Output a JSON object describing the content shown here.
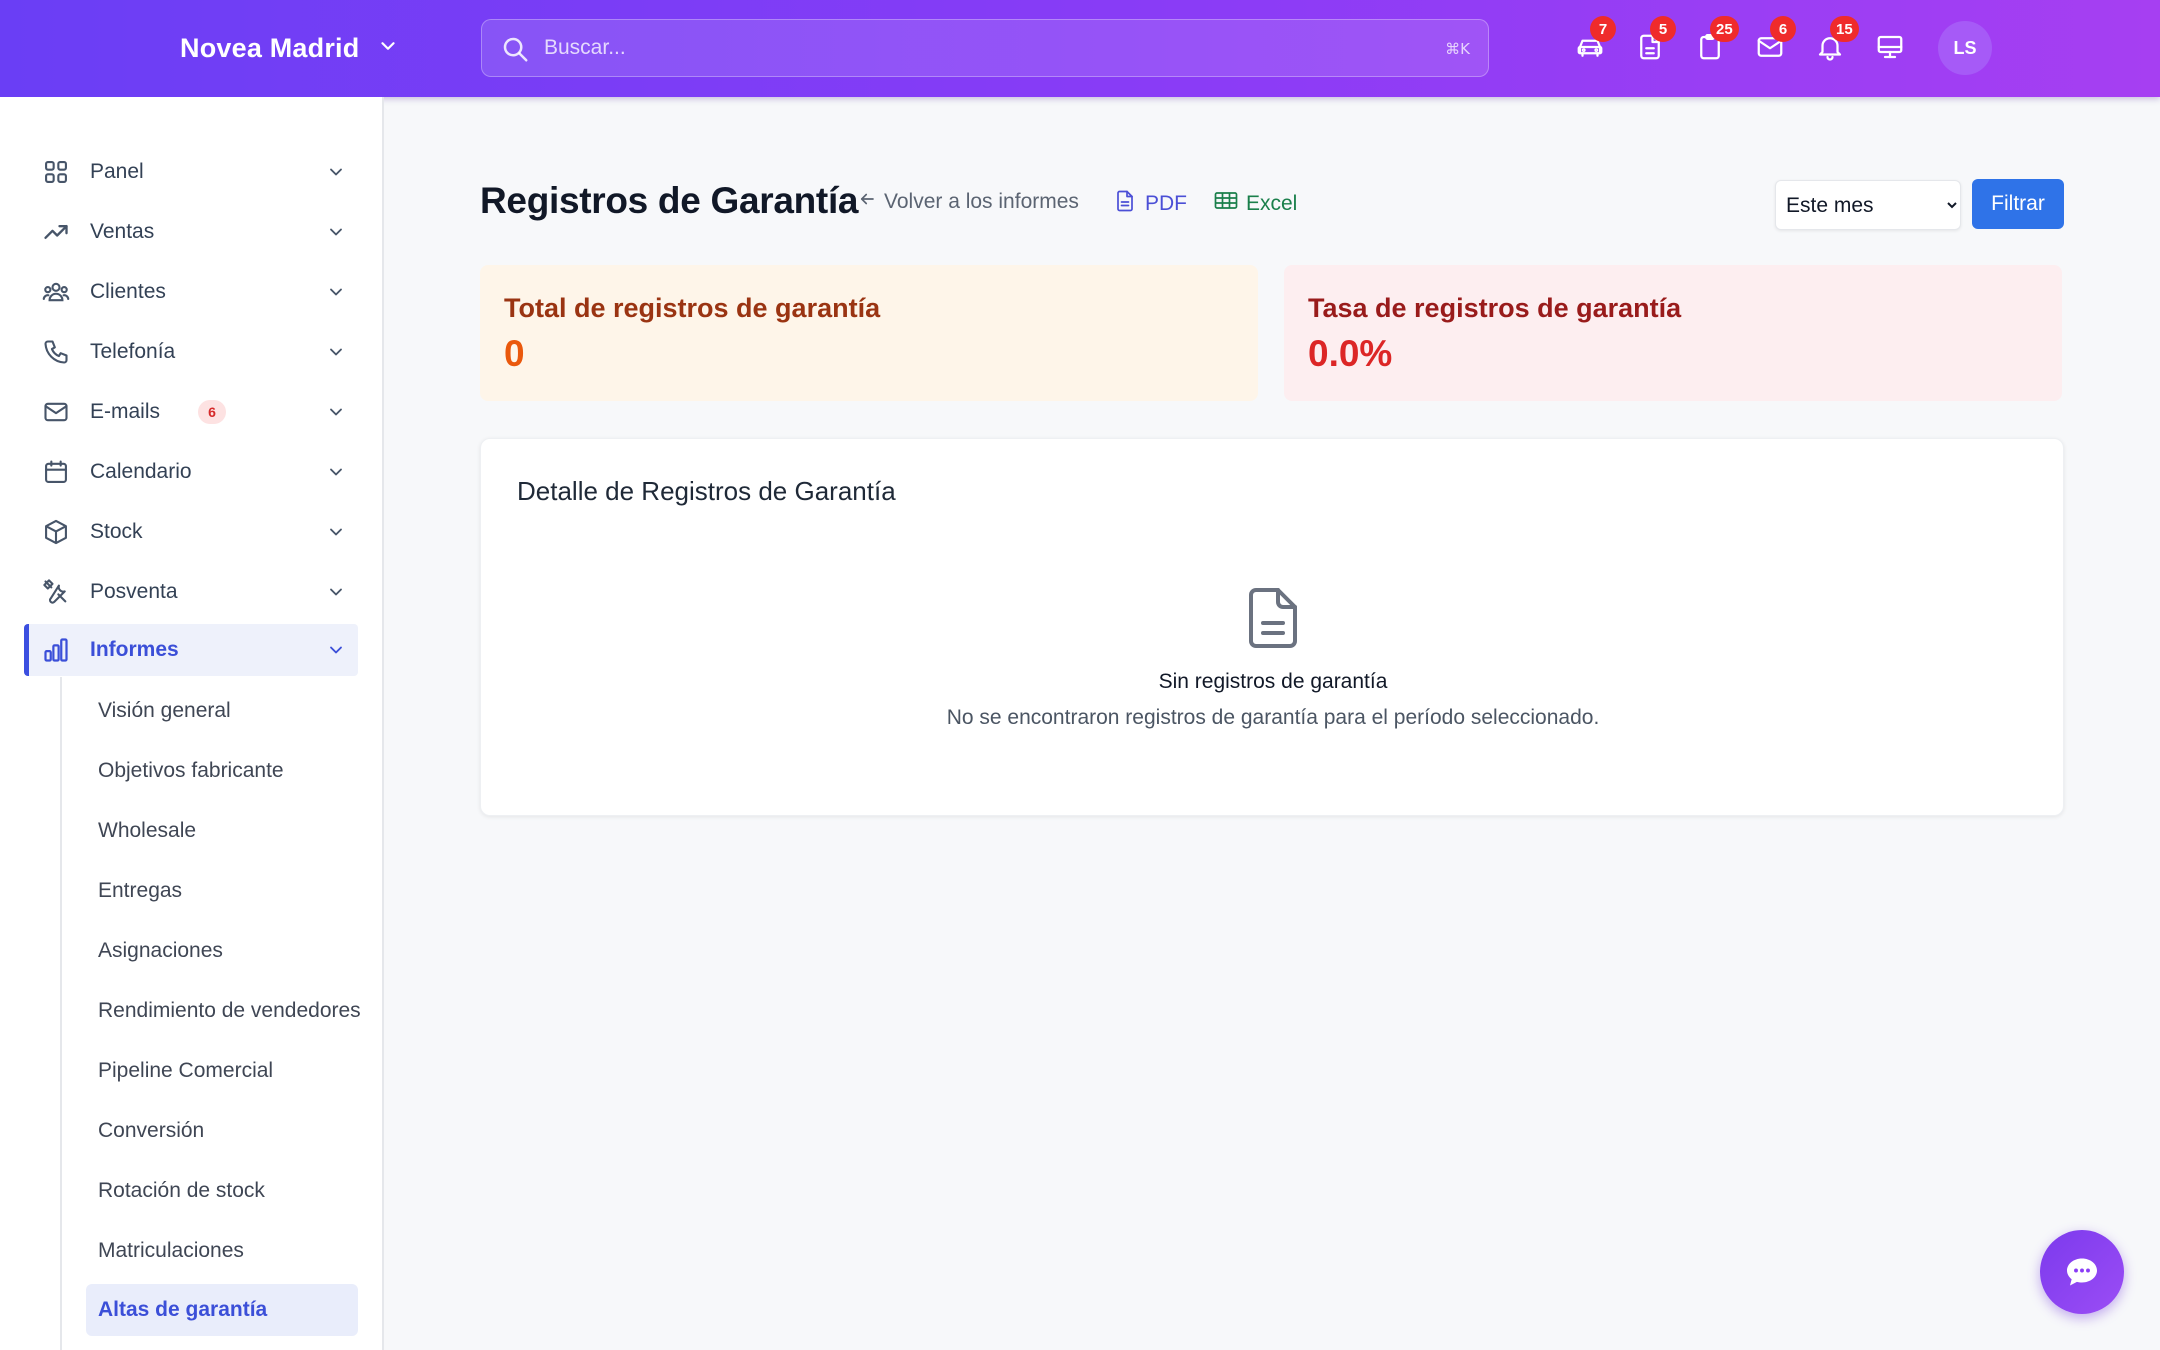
{
  "header": {
    "brand": "Novea Madrid",
    "search_placeholder": "Buscar...",
    "search_shortcut": "⌘K",
    "icons": [
      {
        "name": "car-icon",
        "badge": "7"
      },
      {
        "name": "document-icon",
        "badge": "5"
      },
      {
        "name": "clipboard-icon",
        "badge": "25"
      },
      {
        "name": "mail-icon",
        "badge": "6"
      },
      {
        "name": "bell-icon",
        "badge": "15"
      },
      {
        "name": "monitor-icon",
        "badge": ""
      }
    ],
    "avatar_initials": "LS"
  },
  "sidebar": {
    "items": [
      {
        "label": "Panel",
        "icon": "grid-icon"
      },
      {
        "label": "Ventas",
        "icon": "trending-up-icon"
      },
      {
        "label": "Clientes",
        "icon": "users-icon"
      },
      {
        "label": "Telefonía",
        "icon": "phone-icon"
      },
      {
        "label": "E-mails",
        "icon": "mail-icon",
        "badge": "6"
      },
      {
        "label": "Calendario",
        "icon": "calendar-icon"
      },
      {
        "label": "Stock",
        "icon": "box-icon"
      },
      {
        "label": "Posventa",
        "icon": "tools-icon"
      },
      {
        "label": "Informes",
        "icon": "bar-chart-icon",
        "active": true
      }
    ],
    "subitems": [
      {
        "label": "Visión general"
      },
      {
        "label": "Objetivos fabricante"
      },
      {
        "label": "Wholesale"
      },
      {
        "label": "Entregas"
      },
      {
        "label": "Asignaciones"
      },
      {
        "label": "Rendimiento de vendedores"
      },
      {
        "label": "Pipeline Comercial"
      },
      {
        "label": "Conversión"
      },
      {
        "label": "Rotación de stock"
      },
      {
        "label": "Matriculaciones"
      },
      {
        "label": "Altas de garantía",
        "active": true
      }
    ]
  },
  "main": {
    "title": "Registros de Garantía",
    "back_link": "Volver a los informes",
    "pdf_label": "PDF",
    "excel_label": "Excel",
    "period_selected": "Este mes",
    "filter_label": "Filtrar",
    "stats": [
      {
        "label": "Total de registros de garantía",
        "value": "0",
        "color": "#ea580c"
      },
      {
        "label": "Tasa de registros de garantía",
        "value": "0.0%",
        "color": "#dc2626"
      }
    ],
    "detail": {
      "title": "Detalle de Registros de Garantía",
      "empty_title": "Sin registros de garantía",
      "empty_subtitle": "No se encontraron registros de garantía para el período seleccionado."
    }
  },
  "colors": {
    "accent": "#3b4fd8",
    "header_gradient_start": "#6a3ef5",
    "header_gradient_end": "#a63ff2",
    "badge": "#ef2b2b",
    "filter_button": "#2f73e8"
  }
}
